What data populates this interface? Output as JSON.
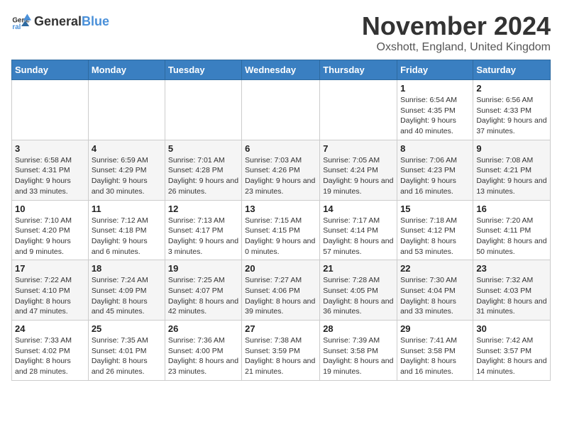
{
  "logo": {
    "text_general": "General",
    "text_blue": "Blue"
  },
  "title": {
    "month": "November 2024",
    "location": "Oxshott, England, United Kingdom"
  },
  "days_of_week": [
    "Sunday",
    "Monday",
    "Tuesday",
    "Wednesday",
    "Thursday",
    "Friday",
    "Saturday"
  ],
  "weeks": [
    [
      {
        "day": "",
        "info": ""
      },
      {
        "day": "",
        "info": ""
      },
      {
        "day": "",
        "info": ""
      },
      {
        "day": "",
        "info": ""
      },
      {
        "day": "",
        "info": ""
      },
      {
        "day": "1",
        "info": "Sunrise: 6:54 AM\nSunset: 4:35 PM\nDaylight: 9 hours and 40 minutes."
      },
      {
        "day": "2",
        "info": "Sunrise: 6:56 AM\nSunset: 4:33 PM\nDaylight: 9 hours and 37 minutes."
      }
    ],
    [
      {
        "day": "3",
        "info": "Sunrise: 6:58 AM\nSunset: 4:31 PM\nDaylight: 9 hours and 33 minutes."
      },
      {
        "day": "4",
        "info": "Sunrise: 6:59 AM\nSunset: 4:29 PM\nDaylight: 9 hours and 30 minutes."
      },
      {
        "day": "5",
        "info": "Sunrise: 7:01 AM\nSunset: 4:28 PM\nDaylight: 9 hours and 26 minutes."
      },
      {
        "day": "6",
        "info": "Sunrise: 7:03 AM\nSunset: 4:26 PM\nDaylight: 9 hours and 23 minutes."
      },
      {
        "day": "7",
        "info": "Sunrise: 7:05 AM\nSunset: 4:24 PM\nDaylight: 9 hours and 19 minutes."
      },
      {
        "day": "8",
        "info": "Sunrise: 7:06 AM\nSunset: 4:23 PM\nDaylight: 9 hours and 16 minutes."
      },
      {
        "day": "9",
        "info": "Sunrise: 7:08 AM\nSunset: 4:21 PM\nDaylight: 9 hours and 13 minutes."
      }
    ],
    [
      {
        "day": "10",
        "info": "Sunrise: 7:10 AM\nSunset: 4:20 PM\nDaylight: 9 hours and 9 minutes."
      },
      {
        "day": "11",
        "info": "Sunrise: 7:12 AM\nSunset: 4:18 PM\nDaylight: 9 hours and 6 minutes."
      },
      {
        "day": "12",
        "info": "Sunrise: 7:13 AM\nSunset: 4:17 PM\nDaylight: 9 hours and 3 minutes."
      },
      {
        "day": "13",
        "info": "Sunrise: 7:15 AM\nSunset: 4:15 PM\nDaylight: 9 hours and 0 minutes."
      },
      {
        "day": "14",
        "info": "Sunrise: 7:17 AM\nSunset: 4:14 PM\nDaylight: 8 hours and 57 minutes."
      },
      {
        "day": "15",
        "info": "Sunrise: 7:18 AM\nSunset: 4:12 PM\nDaylight: 8 hours and 53 minutes."
      },
      {
        "day": "16",
        "info": "Sunrise: 7:20 AM\nSunset: 4:11 PM\nDaylight: 8 hours and 50 minutes."
      }
    ],
    [
      {
        "day": "17",
        "info": "Sunrise: 7:22 AM\nSunset: 4:10 PM\nDaylight: 8 hours and 47 minutes."
      },
      {
        "day": "18",
        "info": "Sunrise: 7:24 AM\nSunset: 4:09 PM\nDaylight: 8 hours and 45 minutes."
      },
      {
        "day": "19",
        "info": "Sunrise: 7:25 AM\nSunset: 4:07 PM\nDaylight: 8 hours and 42 minutes."
      },
      {
        "day": "20",
        "info": "Sunrise: 7:27 AM\nSunset: 4:06 PM\nDaylight: 8 hours and 39 minutes."
      },
      {
        "day": "21",
        "info": "Sunrise: 7:28 AM\nSunset: 4:05 PM\nDaylight: 8 hours and 36 minutes."
      },
      {
        "day": "22",
        "info": "Sunrise: 7:30 AM\nSunset: 4:04 PM\nDaylight: 8 hours and 33 minutes."
      },
      {
        "day": "23",
        "info": "Sunrise: 7:32 AM\nSunset: 4:03 PM\nDaylight: 8 hours and 31 minutes."
      }
    ],
    [
      {
        "day": "24",
        "info": "Sunrise: 7:33 AM\nSunset: 4:02 PM\nDaylight: 8 hours and 28 minutes."
      },
      {
        "day": "25",
        "info": "Sunrise: 7:35 AM\nSunset: 4:01 PM\nDaylight: 8 hours and 26 minutes."
      },
      {
        "day": "26",
        "info": "Sunrise: 7:36 AM\nSunset: 4:00 PM\nDaylight: 8 hours and 23 minutes."
      },
      {
        "day": "27",
        "info": "Sunrise: 7:38 AM\nSunset: 3:59 PM\nDaylight: 8 hours and 21 minutes."
      },
      {
        "day": "28",
        "info": "Sunrise: 7:39 AM\nSunset: 3:58 PM\nDaylight: 8 hours and 19 minutes."
      },
      {
        "day": "29",
        "info": "Sunrise: 7:41 AM\nSunset: 3:58 PM\nDaylight: 8 hours and 16 minutes."
      },
      {
        "day": "30",
        "info": "Sunrise: 7:42 AM\nSunset: 3:57 PM\nDaylight: 8 hours and 14 minutes."
      }
    ]
  ]
}
